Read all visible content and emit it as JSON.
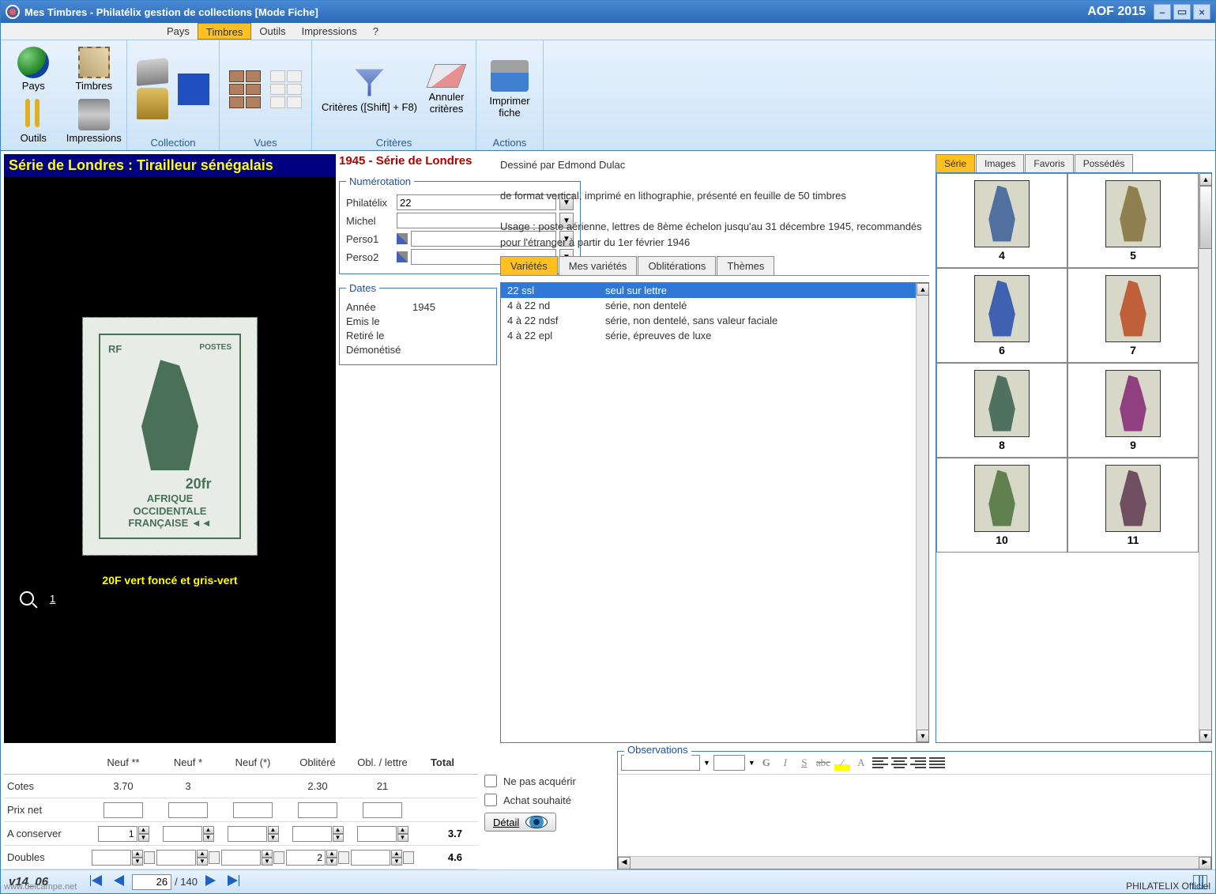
{
  "window": {
    "title": "Mes Timbres - Philatélix gestion de collections [Mode Fiche]",
    "right_title": "AOF 2015"
  },
  "menu": {
    "pays": "Pays",
    "timbres": "Timbres",
    "outils": "Outils",
    "impressions": "Impressions",
    "help": "?"
  },
  "nav": {
    "pays": "Pays",
    "timbres": "Timbres",
    "outils": "Outils",
    "impressions": "Impressions"
  },
  "ribbon": {
    "collection": "Collection",
    "vues": "Vues",
    "criteres": "Critères",
    "criteres_btn": "Critères ([Shift] + F8)",
    "annuler": "Annuler critères",
    "actions": "Actions",
    "imprimer": "Imprimer fiche"
  },
  "stamp": {
    "header": "Série de Londres : Tirailleur sénégalais",
    "top_rf": "RF",
    "postes": "POSTES",
    "value": "20fr",
    "country_line1": "AFRIQUE",
    "country_line2": "OCCIDENTALE",
    "country_line3": "FRANÇAISE ◄◄",
    "caption": "20F vert foncé et gris-vert",
    "zoom": "1"
  },
  "series_title": "1945 - Série de Londres",
  "numbering": {
    "legend": "Numérotation",
    "philatelix_label": "Philatélix",
    "philatelix_val": "22",
    "michel_label": "Michel",
    "p1_label": "Perso1",
    "p2_label": "Perso2"
  },
  "dates": {
    "legend": "Dates",
    "annee_label": "Année",
    "annee_val": "1945",
    "emis_label": "Emis le",
    "retire_label": "Retiré le",
    "demon_label": "Démonétisé"
  },
  "description": {
    "line1": "Dessiné par Edmond Dulac",
    "line2": "de format vertical, imprimé en lithographie, présenté en feuille de 50 timbres",
    "line3": "Usage : poste aérienne, lettres de 8ème échelon jusqu'au 31 décembre 1945, recommandés pour l'étranger à partir du 1er février 1946"
  },
  "subtabs": {
    "varietes": "Variétés",
    "mes_varietes": "Mes variétés",
    "obliterations": "Oblitérations",
    "themes": "Thèmes"
  },
  "varieties": [
    {
      "code": "22 ssl",
      "desc": "seul sur lettre"
    },
    {
      "code": "4 à 22 nd",
      "desc": "série, non dentelé"
    },
    {
      "code": "4 à 22 ndsf",
      "desc": "série, non dentelé, sans valeur faciale"
    },
    {
      "code": "4 à 22 epl",
      "desc": "série, épreuves de luxe"
    }
  ],
  "gallery_tabs": {
    "serie": "Série",
    "images": "Images",
    "favoris": "Favoris",
    "possedes": "Possédés"
  },
  "gallery": [
    "4",
    "5",
    "6",
    "7",
    "8",
    "9",
    "10",
    "11"
  ],
  "price_headers": {
    "neuf_ss": "Neuf **",
    "neuf_s": "Neuf *",
    "neuf_p": "Neuf (*)",
    "oblitere": "Oblitéré",
    "obl_lettre": "Obl. / lettre",
    "total": "Total"
  },
  "prices": {
    "cotes_label": "Cotes",
    "cotes": {
      "neuf_ss": "3.70",
      "neuf_s": "3",
      "neuf_p": "",
      "oblitere": "2.30",
      "obl_lettre": "21"
    },
    "prixnet_label": "Prix net",
    "conserver_label": "A conserver",
    "conserver": {
      "neuf_ss": "1"
    },
    "conserver_total": "3.7",
    "doubles_label": "Doubles",
    "doubles": {
      "oblitere": "2"
    },
    "doubles_total": "4.6"
  },
  "checks": {
    "acquerir": "Ne pas acquérir",
    "souhaite": "Achat souhaité",
    "detail": "Détail"
  },
  "obs": {
    "legend": "Observations"
  },
  "footer": {
    "version": "v14_06",
    "current": "26",
    "total": "140"
  },
  "watermark_left": "www.delcampe.net",
  "watermark_right": "PHILATELIX Officiel"
}
